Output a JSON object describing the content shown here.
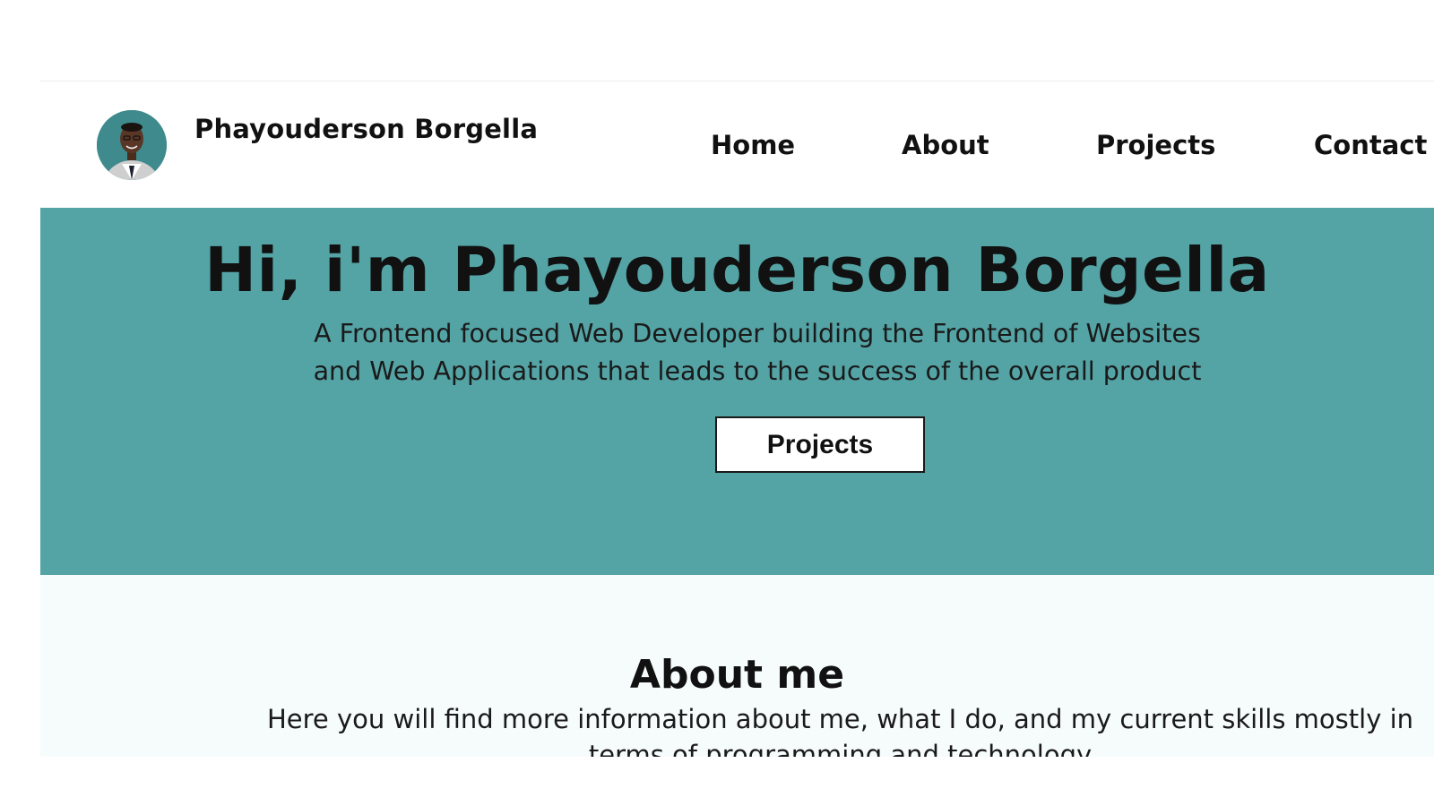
{
  "colors": {
    "hero_bg": "#54a3a5",
    "about_bg": "#f6fcfc",
    "nav_bg": "#ffffff",
    "text": "#111111"
  },
  "navbar": {
    "avatar_icon": "profile-photo",
    "brand": "Phayouderson Borgella",
    "links": [
      "Home",
      "About",
      "Projects",
      "Contact"
    ]
  },
  "hero": {
    "title": "Hi, i'm Phayouderson Borgella",
    "subtitle": "A Frontend focused Web Developer building the Frontend of Websites and Web Applications that leads to the success of the overall product",
    "button": "Projects"
  },
  "about": {
    "title": "About me",
    "text": "Here you will find more information about me, what I do, and my current skills mostly in terms of programming and technology"
  }
}
